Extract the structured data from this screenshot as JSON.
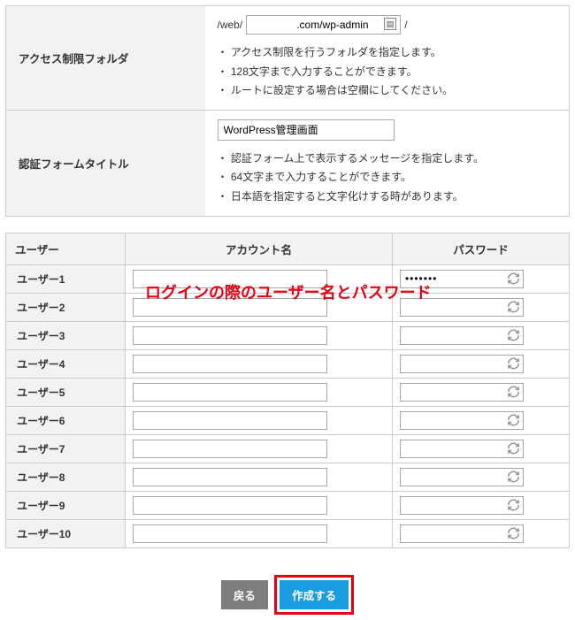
{
  "folder": {
    "label": "アクセス制限フォルダ",
    "path_prefix": "/web/",
    "path_value": "               .com/wp-admin",
    "path_suffix": "/",
    "notes": [
      "アクセス制限を行うフォルダを指定します。",
      "128文字まで入力することができます。",
      "ルートに設定する場合は空欄にしてください。"
    ]
  },
  "form_title": {
    "label": "認証フォームタイトル",
    "value": "WordPress管理画面",
    "notes": [
      "認証フォーム上で表示するメッセージを指定します。",
      "64文字まで入力することができます。",
      "日本語を指定すると文字化けする時があります。"
    ]
  },
  "users_table": {
    "headers": {
      "user": "ユーザー",
      "account": "アカウント名",
      "password": "パスワード"
    },
    "rows": [
      {
        "label": "ユーザー1",
        "account": "",
        "password": "•••••••"
      },
      {
        "label": "ユーザー2",
        "account": "",
        "password": ""
      },
      {
        "label": "ユーザー3",
        "account": "",
        "password": ""
      },
      {
        "label": "ユーザー4",
        "account": "",
        "password": ""
      },
      {
        "label": "ユーザー5",
        "account": "",
        "password": ""
      },
      {
        "label": "ユーザー6",
        "account": "",
        "password": ""
      },
      {
        "label": "ユーザー7",
        "account": "",
        "password": ""
      },
      {
        "label": "ユーザー8",
        "account": "",
        "password": ""
      },
      {
        "label": "ユーザー9",
        "account": "",
        "password": ""
      },
      {
        "label": "ユーザー10",
        "account": "",
        "password": ""
      }
    ]
  },
  "callout_text": "ログインの際のユーザー名とパスワード",
  "buttons": {
    "back": "戻る",
    "submit": "作成する"
  }
}
